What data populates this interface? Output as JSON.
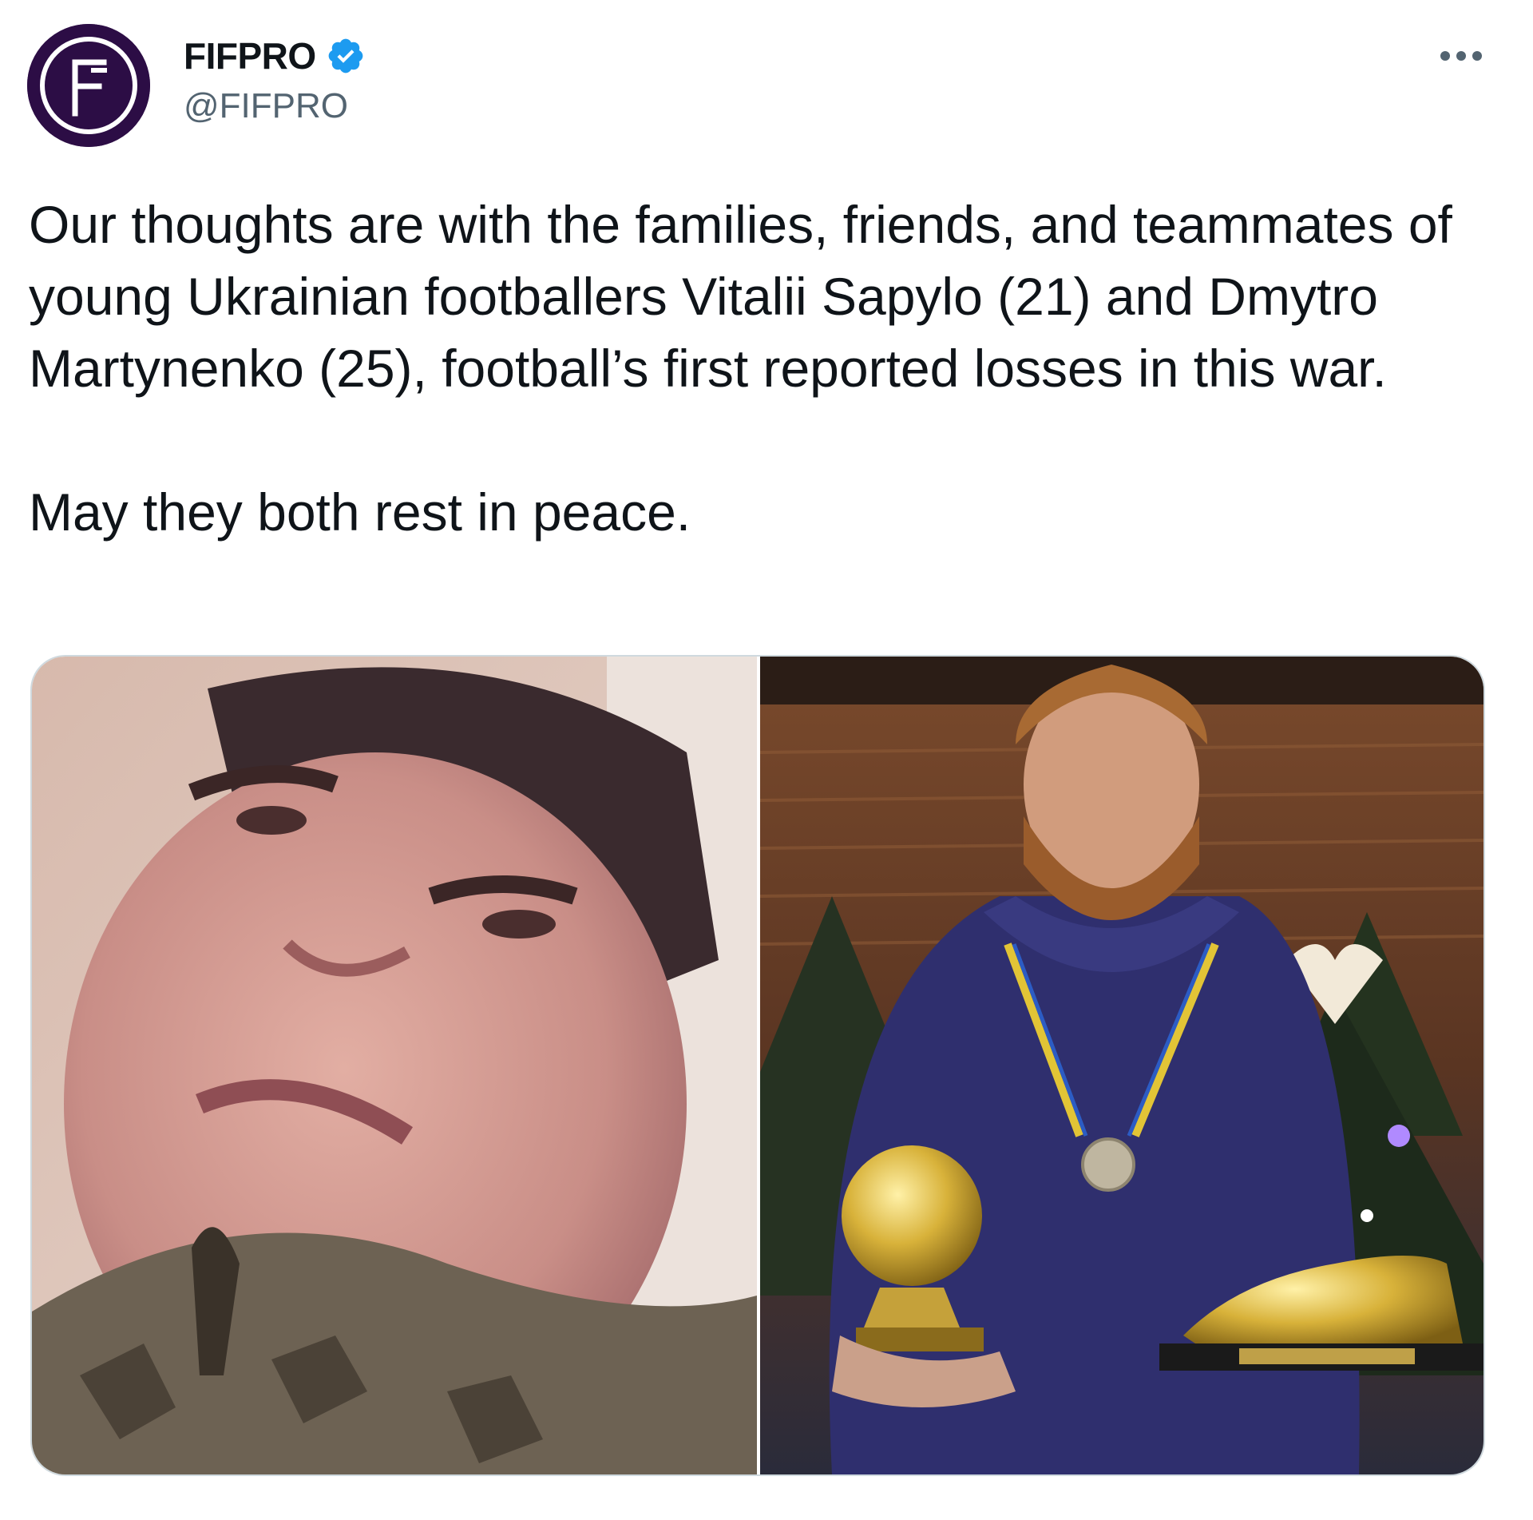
{
  "author": {
    "display_name": "FIFPRO",
    "handle": "@FIFPRO",
    "verified": true,
    "avatar_icon": "fifpro-logo",
    "avatar_color": "#2c0d45"
  },
  "tweet": {
    "paragraphs": [
      "Our thoughts are with the families, friends, and teammates of young Ukrainian footballers Vitalii Sapylo (21) and Dmytro Martynenko (25), football’s first reported losses in this war.",
      "May they both rest in peace."
    ]
  },
  "media": {
    "count": 2,
    "photos": [
      {
        "icon": "photo-portrait-selfie"
      },
      {
        "icon": "photo-player-with-trophies"
      }
    ]
  },
  "icons": {
    "verified": "verified-badge-icon",
    "more": "more-options-icon"
  },
  "colors": {
    "text_primary": "#0f1419",
    "text_secondary": "#536471",
    "verified_blue": "#1d9bf0",
    "border": "#cfd9de"
  }
}
